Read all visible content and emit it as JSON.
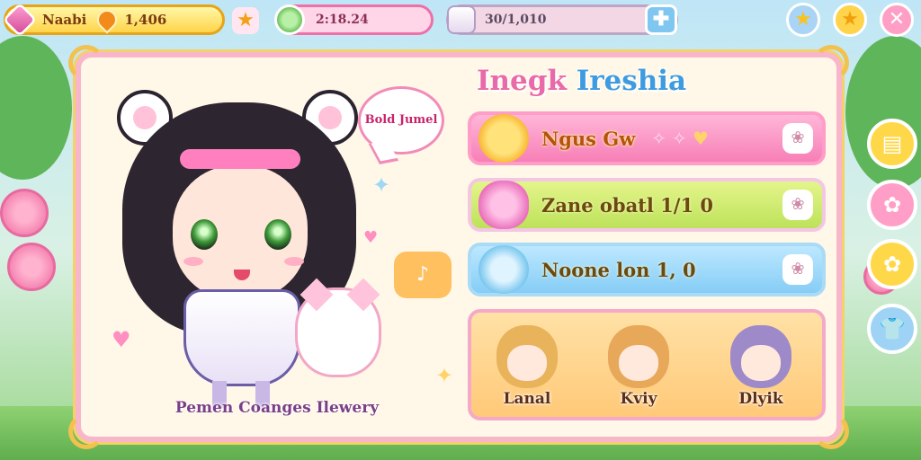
{
  "topbar": {
    "player_name": "Naabi",
    "coins": "1,406",
    "energy": "2:18.24",
    "progress": "30/1,010",
    "icons": {
      "gem": "gem-icon",
      "coin": "coin-icon",
      "star": "star-icon",
      "energy": "cup-icon",
      "progress": "box-icon",
      "add": "plus-icon",
      "favorite": "star-icon",
      "achievement": "star-icon",
      "close": "close-icon"
    }
  },
  "character": {
    "speech_text": "Bold Jumel",
    "caption": "Pemen Coanges Ilewery"
  },
  "panel": {
    "title_part1": "Inegk",
    "title_part2": "Ireshia",
    "rows": [
      {
        "label": "Ngus Gw",
        "icon": "cat-icon"
      },
      {
        "label": "Zane obatl 1/1 0",
        "icon": "bean-icon"
      },
      {
        "label": "Noone lon 1, 0",
        "icon": "blue-cat-icon"
      }
    ],
    "team": [
      {
        "name": "Lanal"
      },
      {
        "name": "Kviy"
      },
      {
        "name": "Dlyik"
      }
    ]
  },
  "side_menu": [
    "card-icon",
    "flower-icon",
    "flower-icon",
    "shirt-icon"
  ],
  "colors": {
    "panel_border": "#f7b6c9",
    "title_pink": "#e96aa8",
    "title_blue": "#3f9be0",
    "row_pink": "#f77fb7",
    "row_green": "#bde25a",
    "row_blue": "#85cdf6"
  }
}
